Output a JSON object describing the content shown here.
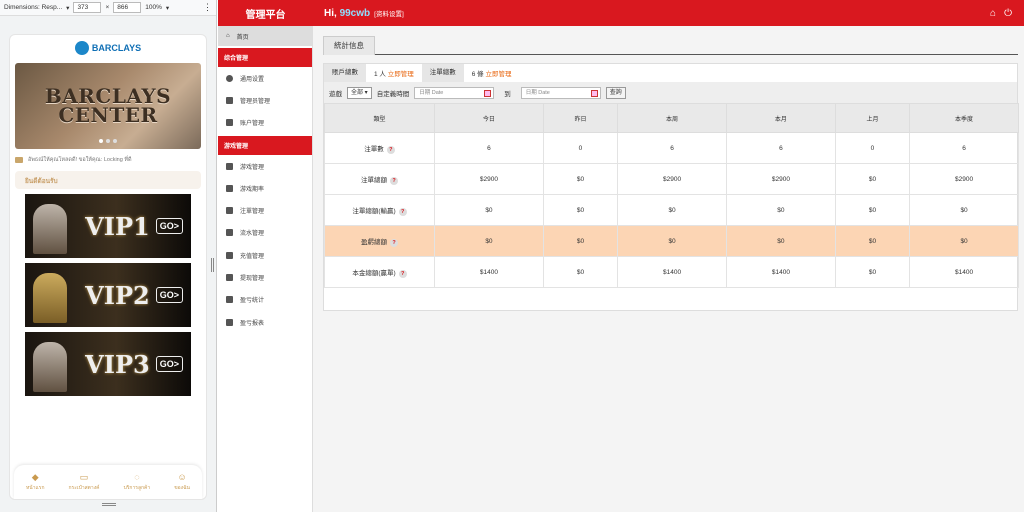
{
  "devtools": {
    "dimensions_label": "Dimensions: Resp...",
    "width": "373",
    "height": "866",
    "zoom": "100%"
  },
  "mobile": {
    "logo_text": "BARCLAYS",
    "banner_text": "BARCLAYS CENTER",
    "marquee": "อัพธณ์ให้คุณโหลดดี! ขอให้คุณ: Locking ที่ดี",
    "recommend": "ยินดีต้อนรับ",
    "vips": [
      {
        "label": "VIP1",
        "go": "GO>"
      },
      {
        "label": "VIP2",
        "go": "GO>"
      },
      {
        "label": "VIP3",
        "go": "GO>"
      }
    ],
    "nav": [
      {
        "icon": "diamond-icon",
        "label": "หน้าแรก"
      },
      {
        "icon": "wallet-icon",
        "label": "กระเป๋าสตางค์"
      },
      {
        "icon": "chat-icon",
        "label": "บริการลูกค้า"
      },
      {
        "icon": "user-icon",
        "label": "ของฉัน"
      }
    ]
  },
  "header": {
    "brand": "管理平台",
    "greeting": "Hi,",
    "username": "99cwb",
    "profile_link": "[资料设置]",
    "accent": "#d9181f"
  },
  "sidebar": {
    "home": "首页",
    "sections": [
      {
        "title": "综合管理",
        "items": [
          "通用设置",
          "管理员管理",
          "账户管理"
        ]
      },
      {
        "title": "游戏管理",
        "items": [
          "游戏管理",
          "游戏期率",
          "注單管理",
          "流水管理",
          "充值管理",
          "提现管理",
          "盈亏统计",
          "盈亏报表"
        ]
      }
    ]
  },
  "main": {
    "tab": "統計信息",
    "summary": {
      "users_label": "賬戶總數",
      "users_value": "1 人",
      "users_link": "立即管理",
      "bets_label": "注單總數",
      "bets_value": "6 條",
      "bets_link": "立即管理"
    },
    "filter": {
      "game_label": "遊戲",
      "game_value": "全部",
      "date_label": "自定義時間",
      "start_placeholder": "日期 Date",
      "to_label": "到",
      "end_placeholder": "日期 Date",
      "query_button": "查詢"
    },
    "table": {
      "headers": [
        "類型",
        "今日",
        "昨日",
        "本周",
        "本月",
        "上月",
        "本季度"
      ],
      "rows": [
        {
          "label": "注單數",
          "values": [
            "6",
            "0",
            "6",
            "6",
            "0",
            "6"
          ],
          "highlight": false
        },
        {
          "label": "注單總額",
          "values": [
            "$2900",
            "$0",
            "$2900",
            "$2900",
            "$0",
            "$2900"
          ],
          "highlight": false
        },
        {
          "label": "注單總額(輸贏)",
          "values": [
            "$0",
            "$0",
            "$0",
            "$0",
            "$0",
            "$0"
          ],
          "highlight": false
        },
        {
          "label": "盈虧總額",
          "values": [
            "$0",
            "$0",
            "$0",
            "$0",
            "$0",
            "$0"
          ],
          "highlight": true
        },
        {
          "label": "本金總額(贏單)",
          "values": [
            "$1400",
            "$0",
            "$1400",
            "$1400",
            "$0",
            "$1400"
          ],
          "highlight": false
        }
      ]
    }
  }
}
